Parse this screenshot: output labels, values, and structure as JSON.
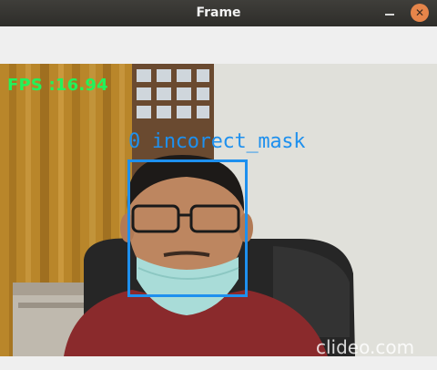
{
  "window": {
    "title": "Frame",
    "buttons": {
      "minimize_icon": "minimize-icon",
      "close_icon": "close-icon",
      "close_glyph": "✕"
    }
  },
  "overlay": {
    "fps_text": "FPS :16.94",
    "detection_text": "0 incorect_mask",
    "watermark": "clideo.com"
  },
  "colors": {
    "titlebar": "#3f3e3a",
    "close_button": "#e6854a",
    "fps_text": "#22f25a",
    "detection": "#1e90ee"
  }
}
